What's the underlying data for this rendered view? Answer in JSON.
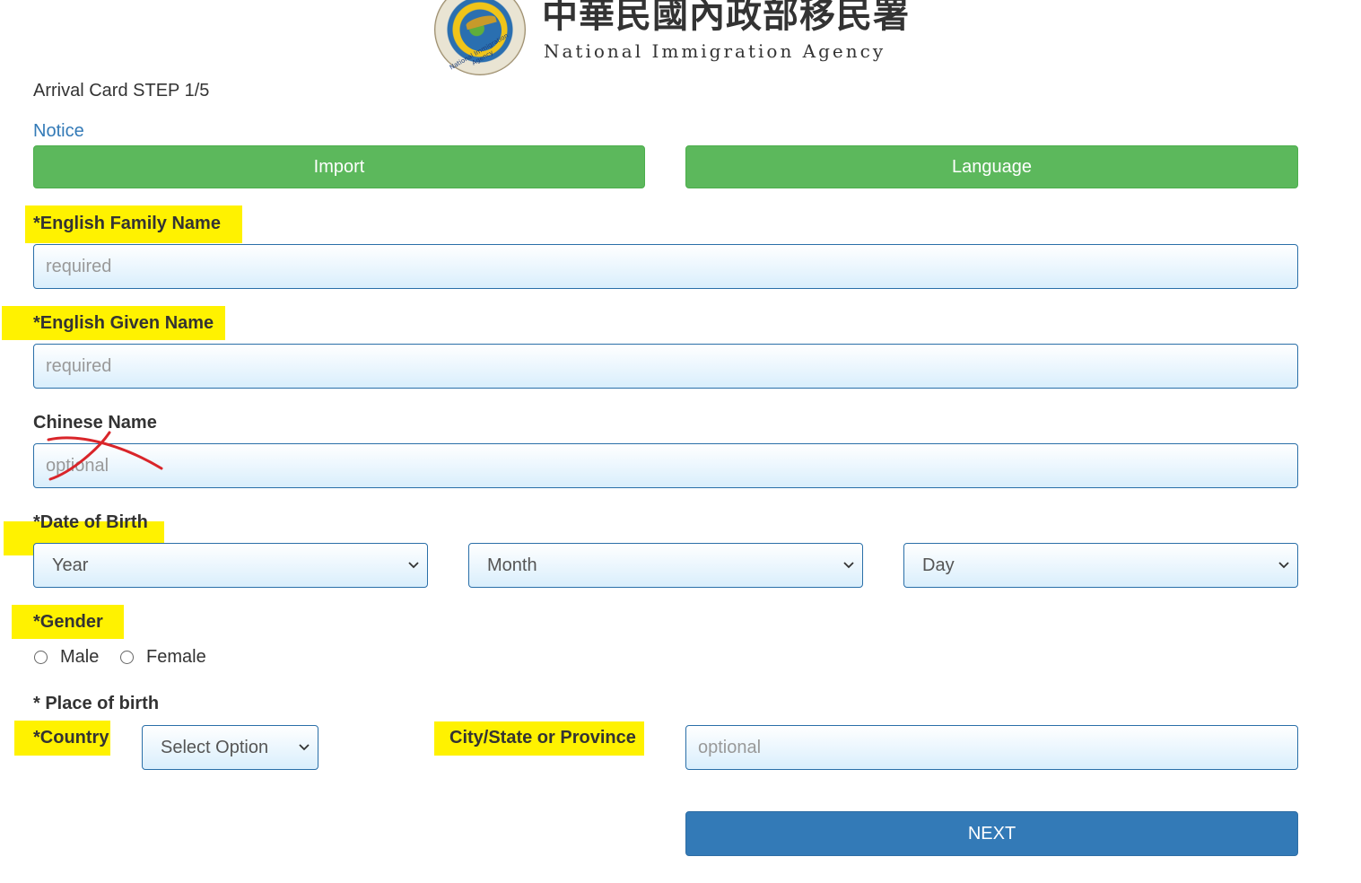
{
  "header": {
    "agency_name_zh": "中華民國內政部移民署",
    "agency_name_en": "National Immigration Agency",
    "seal_text": "National Immigration Agency"
  },
  "form": {
    "step_title": "Arrival Card STEP 1/5",
    "notice_link": "Notice",
    "import_button": "Import",
    "language_button": "Language",
    "family_name": {
      "label": "*English Family Name",
      "placeholder": "required",
      "value": ""
    },
    "given_name": {
      "label": "*English Given Name",
      "placeholder": "required",
      "value": ""
    },
    "chinese_name": {
      "label": "Chinese Name",
      "placeholder": "optional",
      "value": ""
    },
    "date_of_birth": {
      "label": "*Date of Birth",
      "year": "Year",
      "month": "Month",
      "day": "Day"
    },
    "gender": {
      "label": "*Gender",
      "options": [
        "Male",
        "Female"
      ],
      "selected": null
    },
    "place_of_birth": {
      "label": "* Place of birth",
      "country_label": "*Country",
      "country_value": "Select Option",
      "city_label": "City/State or Province",
      "city_placeholder": "optional"
    },
    "next_button": "NEXT"
  },
  "annotations": {
    "highlight_color": "#fff200",
    "pen_color": "#d9252a"
  },
  "colors": {
    "green_button": "#5cb85c",
    "primary_button": "#337ab7",
    "link": "#337ab7"
  }
}
